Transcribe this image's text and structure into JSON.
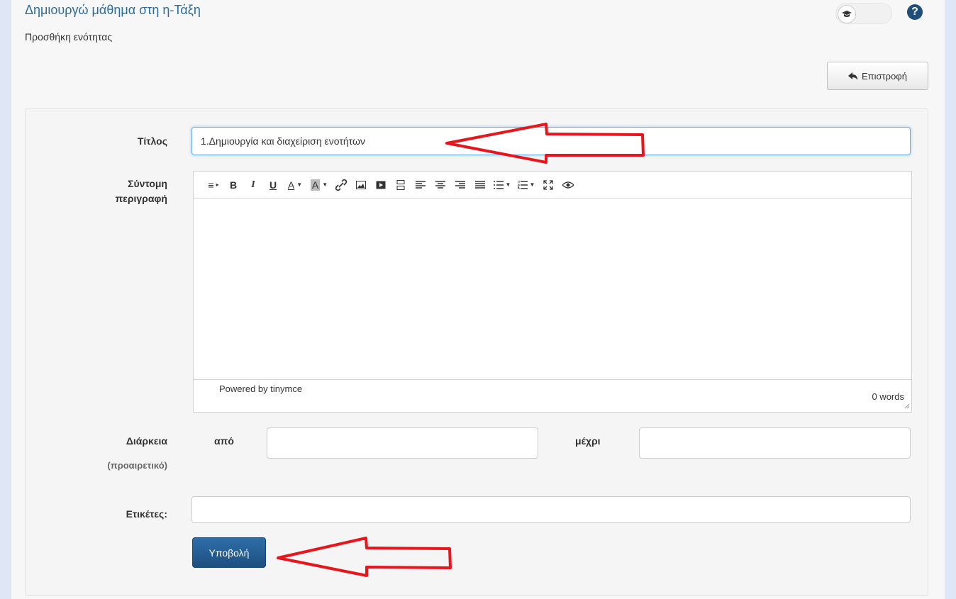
{
  "header": {
    "course_title": "Δημιουργώ μάθημα στη η-Τάξη",
    "subtitle": "Προσθήκη ενότητας",
    "help_glyph": "?"
  },
  "actions": {
    "back_label": "Επιστροφή"
  },
  "form": {
    "title_label": "Τίτλος",
    "title_value": "1.Δημιουργία και διαχείριση ενοτήτων",
    "description_label_line1": "Σύντομη",
    "description_label_line2": "περιγραφή",
    "editor": {
      "powered_by": "Powered by tinymce",
      "word_count": "0 words",
      "toolbar": [
        "format-menu-icon",
        "bold-icon",
        "italic-icon",
        "underline-icon",
        "text-color-icon",
        "background-color-icon",
        "link-icon",
        "image-icon",
        "media-icon",
        "pagebreak-icon",
        "align-left-icon",
        "align-center-icon",
        "align-right-icon",
        "align-justify-icon",
        "bullet-list-icon",
        "numbered-list-icon",
        "fullscreen-icon",
        "preview-icon"
      ]
    },
    "duration_label": "Διάρκεια",
    "duration_optional": "(προαιρετικό)",
    "from_label": "από",
    "from_value": "",
    "to_label": "μέχρι",
    "to_value": "",
    "tags_label": "Ετικέτες:",
    "tags_value": "",
    "submit_label": "Υποβολή"
  },
  "colors": {
    "title_blue": "#2e6c9d",
    "submit_blue": "#245f95",
    "annotation_red": "#e8161c"
  }
}
